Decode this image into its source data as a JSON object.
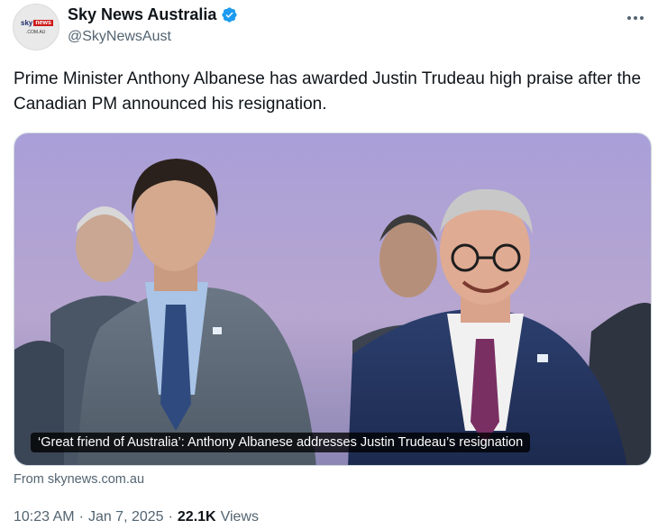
{
  "account": {
    "display_name": "Sky News Australia",
    "handle": "@SkyNewsAust",
    "avatar": {
      "logo_sky": "sky",
      "logo_news": "news",
      "logo_sub": ".COM.AU"
    },
    "verified_color": "#1d9bf0"
  },
  "more_icon": "more-horizontal-icon",
  "tweet": {
    "text": "Prime Minister Anthony Albanese has awarded Justin Trudeau high praise after the Canadian PM announced his resignation."
  },
  "card": {
    "caption": "‘Great friend of Australia’: Anthony Albanese addresses Justin Trudeau’s resignation",
    "source": "From skynews.com.au"
  },
  "meta": {
    "time": "10:23 AM",
    "sep1": "·",
    "date": "Jan 7, 2025",
    "sep2": "·",
    "views_count": "22.1K",
    "views_label": "Views"
  }
}
